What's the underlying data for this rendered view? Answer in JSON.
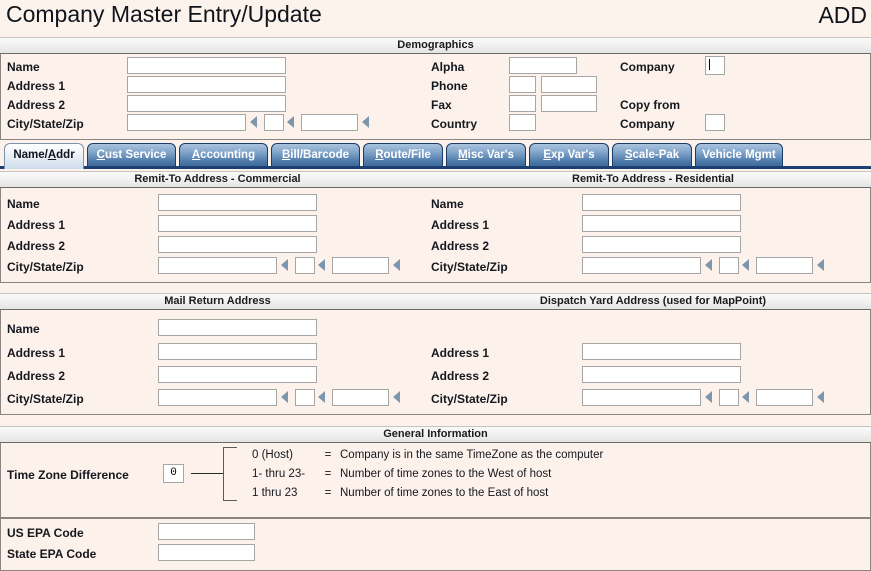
{
  "window": {
    "title": "Company Master Entry/Update",
    "mode": "ADD"
  },
  "sections": {
    "demographics": "Demographics",
    "remit_commercial": "Remit-To Address - Commercial",
    "remit_residential": "Remit-To Address - Residential",
    "mail_return": "Mail Return Address",
    "dispatch_yard": "Dispatch Yard Address  (used for MapPoint)",
    "general_information": "General Information"
  },
  "demographics": {
    "left": {
      "name_label": "Name",
      "address1_label": "Address 1",
      "address2_label": "Address 2",
      "citystatezip_label": "City/State/Zip",
      "name_value": "",
      "address1_value": "",
      "address2_value": "",
      "city_value": "",
      "state_value": "",
      "zip_value": ""
    },
    "middle": {
      "alpha_label": "Alpha",
      "phone_label": "Phone",
      "fax_label": "Fax",
      "country_label": "Country",
      "alpha_value": "",
      "phone_area_value": "",
      "phone_number_value": "",
      "fax_area_value": "",
      "fax_number_value": "",
      "country_value": ""
    },
    "right": {
      "company_label": "Company",
      "copy_from_label": "Copy from",
      "copy_from_company_label": "Company",
      "company_value": "",
      "copy_from_company_value": ""
    }
  },
  "tabs": [
    {
      "label": "Name/Addr",
      "accel": "A",
      "pre": "Name/",
      "post": "ddr",
      "active": true
    },
    {
      "label": "Cust Service",
      "accel": "C",
      "pre": "",
      "post": "ust Service",
      "active": false
    },
    {
      "label": "Accounting",
      "accel": "A",
      "pre": "",
      "post": "ccounting",
      "active": false
    },
    {
      "label": "Bill/Barcode",
      "accel": "B",
      "pre": "",
      "post": "ill/Barcode",
      "active": false
    },
    {
      "label": "Route/File",
      "accel": "R",
      "pre": "",
      "post": "oute/File",
      "active": false
    },
    {
      "label": "Misc Var's",
      "accel": "M",
      "pre": "",
      "post": "isc Var's",
      "active": false
    },
    {
      "label": "Exp Var's",
      "accel": "E",
      "pre": "",
      "post": "xp Var's",
      "active": false
    },
    {
      "label": "Scale-Pak",
      "accel": "S",
      "pre": "",
      "post": "cale-Pak",
      "active": false
    },
    {
      "label": "Vehicle Mgmt",
      "accel": "",
      "pre": "Vehicle Mgmt",
      "post": "",
      "active": false
    }
  ],
  "remit_commercial": {
    "name_label": "Name",
    "address1_label": "Address 1",
    "address2_label": "Address 2",
    "citystatezip_label": "City/State/Zip",
    "name_value": "",
    "address1_value": "",
    "address2_value": "",
    "city_value": "",
    "state_value": "",
    "zip_value": ""
  },
  "remit_residential": {
    "name_label": "Name",
    "address1_label": "Address 1",
    "address2_label": "Address 2",
    "citystatezip_label": "City/State/Zip",
    "name_value": "",
    "address1_value": "",
    "address2_value": "",
    "city_value": "",
    "state_value": "",
    "zip_value": ""
  },
  "mail_return": {
    "name_label": "Name",
    "address1_label": "Address 1",
    "address2_label": "Address 2",
    "citystatezip_label": "City/State/Zip",
    "name_value": "",
    "address1_value": "",
    "address2_value": "",
    "city_value": "",
    "state_value": "",
    "zip_value": ""
  },
  "dispatch_yard": {
    "address1_label": "Address 1",
    "address2_label": "Address 2",
    "citystatezip_label": "City/State/Zip",
    "address1_value": "",
    "address2_value": "",
    "city_value": "",
    "state_value": "",
    "zip_value": ""
  },
  "general_information": {
    "time_zone_label": "Time Zone Difference",
    "time_zone_value": "0",
    "legend": [
      {
        "key": "0 (Host)",
        "eq": "=",
        "desc": "Company is in the same TimeZone as the computer"
      },
      {
        "key": "1- thru 23-",
        "eq": "=",
        "desc": "Number of time zones to the West of host"
      },
      {
        "key": "1  thru 23",
        "eq": "=",
        "desc": "Number of time zones to the East of host"
      }
    ],
    "us_epa_label": "US EPA Code",
    "us_epa_value": "",
    "state_epa_label": "State EPA Code",
    "state_epa_value": ""
  },
  "colors": {
    "form_background": "#fdf1eb",
    "tab_active_text": "#10151c",
    "tab_inactive_bg": "#4e7aaa",
    "tab_underline": "#1c3f73",
    "arrow": "#7d96ae",
    "field_border": "#a6a6a6"
  }
}
